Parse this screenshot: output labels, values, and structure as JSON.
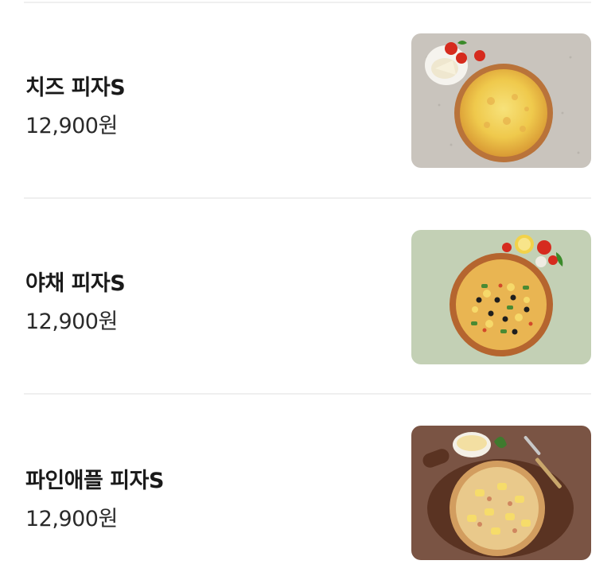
{
  "menu": {
    "items": [
      {
        "name": "치즈 피자S",
        "price": "12,900원",
        "image_icon": "cheese-pizza-photo"
      },
      {
        "name": "야채 피자S",
        "price": "12,900원",
        "image_icon": "vegetable-pizza-photo"
      },
      {
        "name": "파인애플 피자S",
        "price": "12,900원",
        "image_icon": "pineapple-pizza-photo"
      }
    ]
  }
}
